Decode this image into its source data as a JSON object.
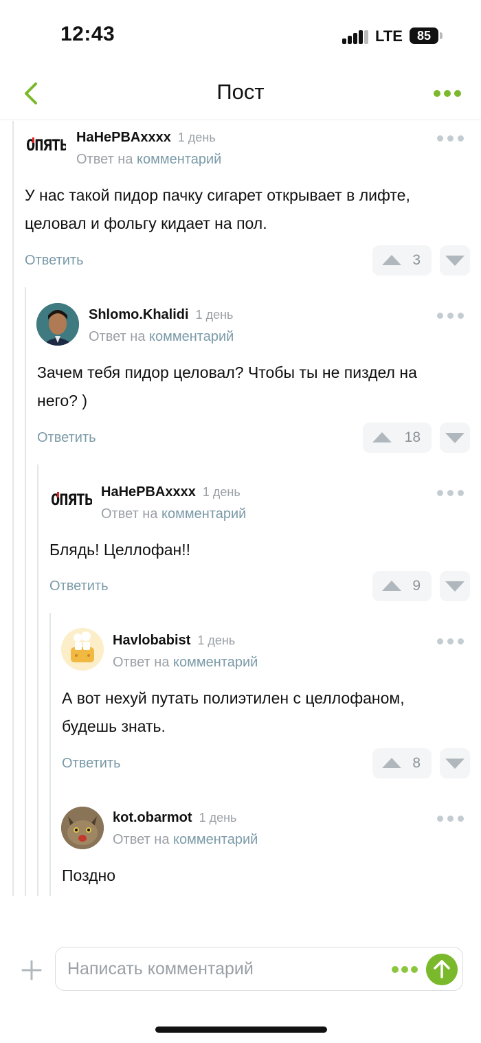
{
  "status_bar": {
    "time": "12:43",
    "network": "LTE",
    "battery": "85"
  },
  "nav": {
    "title": "Пост"
  },
  "labels": {
    "reply_to": "Ответ на",
    "reply_to_link": "комментарий",
    "reply_button": "Ответить"
  },
  "comments": [
    {
      "author": "HaHePBAxxxx",
      "time": "1 день",
      "avatar": "opyat-logo",
      "text_lines": [
        "У нас такой пидор пачку сигарет открывает в лифте,",
        "целовал и фольгу кидает на пол."
      ],
      "votes": "3"
    },
    {
      "author": "Shlomo.Khalidi",
      "time": "1 день",
      "avatar": "boy-photo",
      "text_lines": [
        "Зачем тебя пидор целовал? Чтобы ты не пиздел на",
        "него? )"
      ],
      "votes": "18"
    },
    {
      "author": "HaHePBAxxxx",
      "time": "1 день",
      "avatar": "opyat-logo",
      "text_lines": [
        "Блядь! Целлофан!!"
      ],
      "votes": "9"
    },
    {
      "author": "Havlobabist",
      "time": "1 день",
      "avatar": "toaster-illustration",
      "text_lines": [
        "А вот нехуй путать полиэтилен с целлофаном,",
        "будешь знать."
      ],
      "votes": "8"
    },
    {
      "author": "kot.obarmot",
      "time": "1 день",
      "avatar": "cat-photo",
      "text_lines": [
        "Поздно"
      ]
    }
  ],
  "logo_text": "ОПЯТЬ",
  "composer": {
    "placeholder": "Написать комментарий"
  },
  "colors": {
    "accent": "#7ab82c",
    "link": "#7a9aa8",
    "muted": "#9aa0a6",
    "thread_line": "#e3e6e8"
  }
}
